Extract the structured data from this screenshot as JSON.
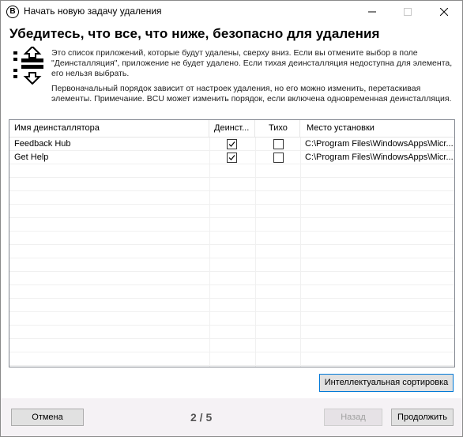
{
  "window": {
    "title": "Начать новую задачу удаления",
    "app_icon_glyph": "B",
    "controls": [
      "minimize-icon",
      "maximize-icon",
      "close-icon"
    ]
  },
  "heading": "Убедитесь, что все, что ниже, безопасно для удаления",
  "info": {
    "icon": "sort-order-icon",
    "paragraph1": "Это список приложений, которые будут удалены, сверху вниз. Если вы отмените выбор в поле \"Деинсталляция\", приложение не будет удалено. Если тихая деинсталляция недоступна для элемента, его нельзя выбрать.",
    "paragraph2": "Первоначальный порядок зависит от настроек удаления, но его можно изменить, перетаскивая элементы. Примечание. BCU может изменить порядок, если включена одновременная деинсталляция."
  },
  "list": {
    "columns": {
      "name": "Имя деинсталлятора",
      "uninstall": "Деинст...",
      "quiet": "Тихо",
      "location": "Место установки"
    },
    "rows": [
      {
        "name": "Feedback Hub",
        "uninstall": true,
        "quiet": false,
        "location": "C:\\Program Files\\WindowsApps\\Micr..."
      },
      {
        "name": "Get Help",
        "uninstall": true,
        "quiet": false,
        "location": "C:\\Program Files\\WindowsApps\\Micr..."
      }
    ]
  },
  "buttons": {
    "smart_sort": "Интеллектуальная сортировка",
    "cancel": "Отмена",
    "back": "Назад",
    "next": "Продолжить"
  },
  "step_indicator": "2 / 5",
  "colors": {
    "accent": "#0078d7",
    "footer_bg": "#f5f2f5",
    "button_bg": "#e1e1e1"
  }
}
